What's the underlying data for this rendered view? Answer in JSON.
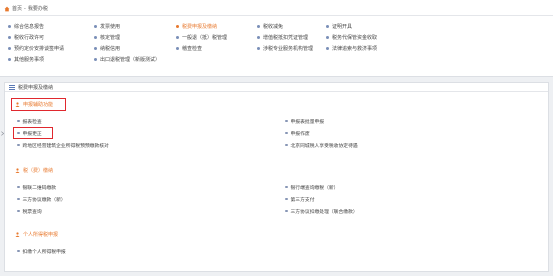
{
  "breadcrumb": {
    "home": "首页",
    "separator": "-",
    "current": "我要办税"
  },
  "menu": {
    "rows": [
      [
        "综合信息报告",
        "发票使用",
        "税费申报及缴纳",
        "税收减免",
        "证明开具"
      ],
      [
        "税收行政许可",
        "核定管理",
        "一般退（抵）税管理",
        "增值税抵扣凭证管理",
        "税务代保管资金收取"
      ],
      [
        "预约定价安排谈签申请",
        "纳税信用",
        "稽查检查",
        "涉税专业服务机构管理",
        "法律追索与救济事项"
      ],
      [
        "其他服务事项",
        "出口退税管理（新版测试）"
      ]
    ],
    "active": "税费申报及缴纳"
  },
  "section": {
    "title": "税费申报及缴纳",
    "groups": [
      {
        "title": "申报辅助功能",
        "left": [
          "报表检查",
          "申报更正",
          "跨地区经营建筑企业所得税预预缴款核对"
        ],
        "right": [
          "申报表批量申报",
          "申报作废",
          "北京同城税人享受税收协定待遇"
        ]
      },
      {
        "title": "税（费）缴纳",
        "left": [
          "银联二维码缴款",
          "三方协议缴款（新）",
          "税票查询"
        ],
        "right": [
          "银行端查询缴税（新）",
          "第三方支付",
          "三方协议扣缴处理（联合缴款）"
        ]
      },
      {
        "title": "个人所得税申报",
        "left": [
          "扣缴个人所得税申报"
        ],
        "right": []
      }
    ]
  },
  "colors": {
    "accent": "#e8792e",
    "highlight": "#e0282e",
    "dot": "#7a8fb8"
  }
}
